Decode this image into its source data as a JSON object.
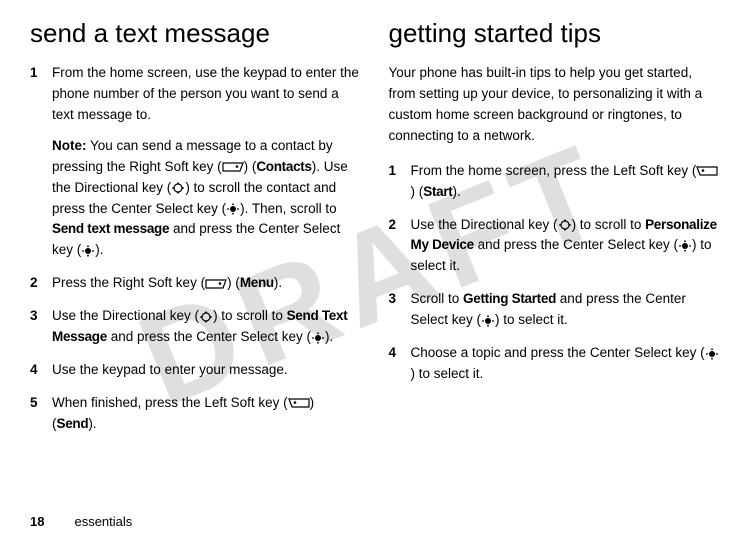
{
  "watermark": "DRAFT",
  "left": {
    "heading": "send a text message",
    "steps": [
      {
        "num": "1",
        "body": "From the home screen, use the keypad to enter the phone number of the person you want to send a text message to.",
        "note_label": "Note:",
        "note_a": " You can send a message to a contact by pressing the Right Soft key (",
        "note_b": ") (",
        "note_contacts": "Contacts",
        "note_c": "). Use the Directional key (",
        "note_d": ") to scroll the contact and press the Center Select key (",
        "note_e": "). Then, scroll to ",
        "note_send": "Send text message",
        "note_f": " and press the Center Select key (",
        "note_g": ")."
      },
      {
        "num": "2",
        "a": "Press the Right Soft key (",
        "b": ") (",
        "menu": "Menu",
        "c": ")."
      },
      {
        "num": "3",
        "a": "Use the Directional key (",
        "b": ") to scroll to ",
        "stm": "Send Text Message",
        "c": " and press the Center Select key (",
        "d": ")."
      },
      {
        "num": "4",
        "a": "Use the keypad to enter your message."
      },
      {
        "num": "5",
        "a": "When finished, press the Left Soft key (",
        "b": ") (",
        "send": "Send",
        "c": ")."
      }
    ]
  },
  "right": {
    "heading": "getting started tips",
    "intro": "Your phone has built-in tips to help you get started, from setting up your device, to personalizing it with a custom home screen background or ringtones, to connecting to a network.",
    "steps": [
      {
        "num": "1",
        "a": "From the home screen, press the Left Soft key (",
        "b": ") (",
        "start": "Start",
        "c": ")."
      },
      {
        "num": "2",
        "a": "Use the Directional key (",
        "b": ") to scroll to ",
        "pmd": "Personalize My Device",
        "c": " and press the Center Select key (",
        "d": ") to select it."
      },
      {
        "num": "3",
        "a": "Scroll to ",
        "gs": "Getting Started",
        "b": " and press the Center Select key (",
        "c": ") to select it."
      },
      {
        "num": "4",
        "a": "Choose a topic and press the Center Select key (",
        "b": ") to select it."
      }
    ]
  },
  "footer": {
    "page": "18",
    "section": "essentials"
  }
}
